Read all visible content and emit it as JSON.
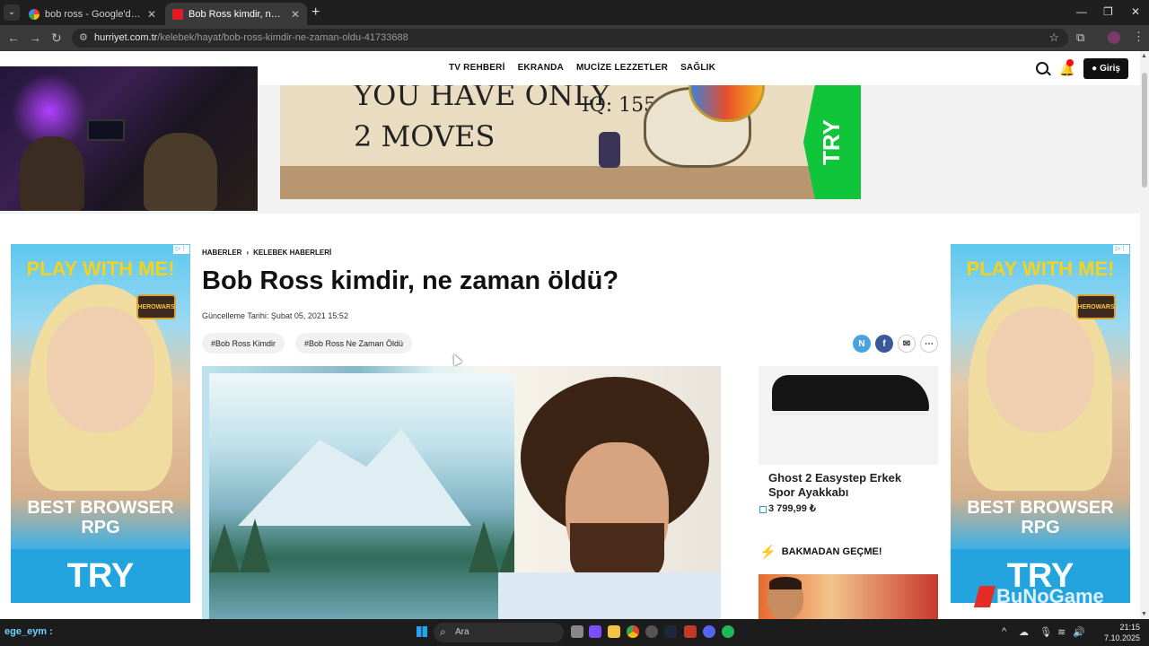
{
  "browser": {
    "tabs": [
      {
        "title": "bob ross - Google'da Ara",
        "active": false
      },
      {
        "title": "Bob Ross kimdir, ne zaman öldü",
        "active": true
      }
    ],
    "url_domain": "hurriyet.com.tr",
    "url_path": "/kelebek/hayat/bob-ross-kimdir-ne-zaman-oldu-41733688"
  },
  "site": {
    "nav": [
      "TV REHBERİ",
      "EKRANDA",
      "MUCİZE LEZZETLER",
      "SAĞLIK"
    ],
    "login_label": "Giriş"
  },
  "banner_ad": {
    "line1": "YOU HAVE ONLY",
    "line2": "2 MOVES",
    "iq": "IQ: 155",
    "cta": "TRY"
  },
  "side_ad": {
    "headline": "PLAY WITH ME!",
    "brand": "HEROWARS",
    "tagline": "BEST BROWSER RPG",
    "cta": "TRY"
  },
  "article": {
    "breadcrumb": [
      "HABERLER",
      "KELEBEK HABERLERİ"
    ],
    "title": "Bob Ross kimdir, ne zaman öldü?",
    "updated": "Güncelleme Tarihi: Şubat 05, 2021 15:52",
    "tags": [
      "#Bob Ross Kimdir",
      "#Bob Ross Ne Zaman Öldü"
    ],
    "share": [
      "N",
      "f",
      "✉",
      "⋯"
    ]
  },
  "sidebar": {
    "product_title": "Ghost 2 Easystep Erkek Spor Ayakkabı",
    "product_price": "3 799,99 ₺",
    "section_title": "BAKMADAN GEÇME!"
  },
  "watermark": "BuNoGame",
  "taskbar": {
    "streamer": "ege_eym :",
    "search_label": "Ara",
    "time": "21:15",
    "date": "7.10.2025"
  },
  "colors": {
    "accent_red": "#e31b23",
    "ad_green": "#10c53a",
    "chrome_dark": "#1f1f1f"
  }
}
